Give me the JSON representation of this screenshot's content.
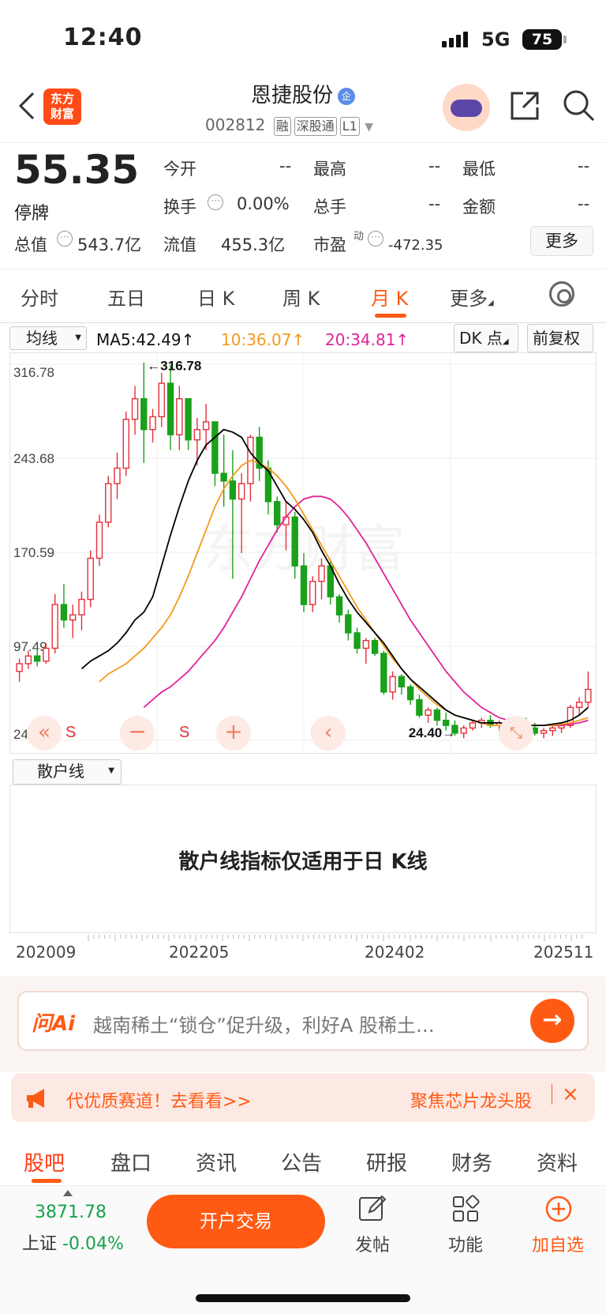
{
  "status": {
    "time": "12:40",
    "network": "5G",
    "battery": "75"
  },
  "header": {
    "logo": [
      "东方",
      "财富"
    ],
    "stock_name": "恩捷股份",
    "badge": "企",
    "code": "002812",
    "tags": [
      "融",
      "深股通",
      "L1"
    ]
  },
  "quote": {
    "price": "55.35",
    "status": "停牌",
    "rows": [
      [
        {
          "label": "今开",
          "value": "--"
        },
        {
          "label": "最高",
          "value": "--"
        },
        {
          "label": "最低",
          "value": "--"
        }
      ],
      [
        {
          "label": "换手",
          "value": "0.00%"
        },
        {
          "label": "总手",
          "value": "--"
        },
        {
          "label": "金额",
          "value": "--"
        }
      ]
    ],
    "total_value_label": "总值",
    "total_value": "543.7亿",
    "float_value_label": "流值",
    "float_value": "455.3亿",
    "pe_label": "市盈",
    "pe_sup": "动",
    "pe_value": "-472.35",
    "more": "更多"
  },
  "tabs": [
    "分时",
    "五日",
    "日 K",
    "周 K",
    "月 K",
    "更多"
  ],
  "active_tab": 4,
  "chart_controls": {
    "ma_select": "均线",
    "ma5": "MA5:42.49",
    "ma10": "10:36.07",
    "ma20": "20:34.81",
    "dk": "DK 点",
    "adjust": "前复权",
    "colors": {
      "ma5": "#000000",
      "ma10": "#f59a1b",
      "ma20": "#e0249a",
      "up": "#e5303a",
      "down": "#1aa01a"
    }
  },
  "chart_data": {
    "type": "candlestick",
    "y_ticks": [
      "316.78",
      "243.68",
      "170.59",
      "97.49",
      "24.40"
    ],
    "ylim": [
      24.4,
      316.78
    ],
    "x_ticks": [
      "202009",
      "202205",
      "202402",
      "202511"
    ],
    "annotations": {
      "max": "316.78",
      "min": "24.40"
    },
    "markers": [
      "S",
      "S",
      "SS"
    ],
    "ohlc": [
      [
        78,
        88,
        70,
        84
      ],
      [
        84,
        94,
        80,
        90
      ],
      [
        90,
        96,
        82,
        86
      ],
      [
        86,
        100,
        84,
        96
      ],
      [
        96,
        138,
        92,
        130
      ],
      [
        130,
        146,
        112,
        118
      ],
      [
        118,
        130,
        104,
        122
      ],
      [
        122,
        140,
        110,
        134
      ],
      [
        134,
        172,
        128,
        166
      ],
      [
        166,
        200,
        160,
        194
      ],
      [
        194,
        230,
        190,
        224
      ],
      [
        224,
        248,
        212,
        236
      ],
      [
        236,
        280,
        230,
        274
      ],
      [
        274,
        300,
        262,
        290
      ],
      [
        290,
        318,
        240,
        266
      ],
      [
        266,
        282,
        256,
        276
      ],
      [
        276,
        310,
        268,
        302
      ],
      [
        302,
        316,
        250,
        262
      ],
      [
        262,
        300,
        250,
        290
      ],
      [
        290,
        282,
        250,
        258
      ],
      [
        258,
        275,
        238,
        266
      ],
      [
        266,
        286,
        250,
        272
      ],
      [
        272,
        272,
        222,
        232
      ],
      [
        232,
        262,
        206,
        226
      ],
      [
        226,
        250,
        150,
        212
      ],
      [
        212,
        232,
        170,
        224
      ],
      [
        224,
        262,
        210,
        260
      ],
      [
        260,
        268,
        226,
        236
      ],
      [
        236,
        242,
        200,
        210
      ],
      [
        210,
        214,
        186,
        192
      ],
      [
        192,
        210,
        172,
        198
      ],
      [
        198,
        202,
        150,
        160
      ],
      [
        160,
        170,
        124,
        130
      ],
      [
        130,
        152,
        124,
        148
      ],
      [
        148,
        166,
        134,
        160
      ],
      [
        160,
        164,
        130,
        136
      ],
      [
        136,
        138,
        116,
        122
      ],
      [
        122,
        126,
        102,
        108
      ],
      [
        108,
        112,
        92,
        96
      ],
      [
        96,
        104,
        84,
        102
      ],
      [
        102,
        104,
        90,
        92
      ],
      [
        92,
        94,
        60,
        62
      ],
      [
        62,
        78,
        56,
        74
      ],
      [
        74,
        76,
        60,
        66
      ],
      [
        66,
        68,
        52,
        56
      ],
      [
        56,
        60,
        42,
        44
      ],
      [
        44,
        50,
        38,
        48
      ],
      [
        48,
        50,
        36,
        40
      ],
      [
        40,
        46,
        32,
        36
      ],
      [
        36,
        40,
        28,
        30
      ],
      [
        30,
        36,
        26,
        34
      ],
      [
        34,
        40,
        32,
        38
      ],
      [
        38,
        42,
        34,
        40
      ],
      [
        40,
        44,
        34,
        36
      ],
      [
        36,
        40,
        30,
        38
      ],
      [
        38,
        42,
        32,
        34
      ],
      [
        34,
        40,
        30,
        38
      ],
      [
        38,
        42,
        32,
        34
      ],
      [
        34,
        38,
        28,
        30
      ],
      [
        30,
        34,
        26,
        32
      ],
      [
        32,
        36,
        28,
        34
      ],
      [
        34,
        38,
        30,
        36
      ],
      [
        36,
        52,
        34,
        50
      ],
      [
        50,
        58,
        44,
        54
      ],
      [
        54,
        78,
        50,
        64
      ]
    ],
    "ma5": [
      80,
      86,
      90,
      94,
      100,
      108,
      118,
      124,
      136,
      160,
      184,
      206,
      226,
      242,
      254,
      260,
      266,
      264,
      260,
      248,
      240,
      234,
      222,
      210,
      204,
      196,
      186,
      172,
      160,
      146,
      134,
      124,
      116,
      108,
      100,
      90,
      80,
      72,
      66,
      60,
      54,
      48,
      44,
      42,
      40,
      38,
      38,
      38,
      37,
      36,
      36,
      36,
      36,
      37,
      38,
      40,
      44,
      50
    ],
    "ma10": [
      70,
      76,
      80,
      84,
      90,
      96,
      104,
      112,
      122,
      136,
      152,
      170,
      188,
      206,
      220,
      230,
      238,
      242,
      240,
      236,
      230,
      222,
      212,
      200,
      188,
      176,
      164,
      152,
      140,
      128,
      118,
      108,
      98,
      88,
      80,
      72,
      64,
      58,
      52,
      48,
      44,
      42,
      40,
      38,
      36,
      36,
      36,
      36,
      36,
      36,
      36,
      36,
      37,
      38,
      40,
      42
    ],
    "ma20": [
      50,
      56,
      62,
      66,
      72,
      78,
      86,
      94,
      102,
      112,
      124,
      136,
      150,
      164,
      176,
      188,
      198,
      206,
      212,
      214,
      214,
      212,
      206,
      198,
      188,
      178,
      166,
      154,
      142,
      130,
      118,
      108,
      98,
      88,
      78,
      70,
      62,
      56,
      50,
      46,
      42,
      40,
      38,
      36,
      36,
      36,
      36,
      36,
      37,
      38,
      40
    ]
  },
  "indicator": {
    "select": "散户线",
    "message": "散户线指标仅适用于日 K线"
  },
  "ai": {
    "logo": "问Ai",
    "text": "越南稀土“锁仓”促升级，利好A 股稀土…"
  },
  "promo": {
    "left": "代优质赛道！去看看>>",
    "right": "聚焦芯片龙头股"
  },
  "bottom_tabs": [
    "股吧",
    "盘口",
    "资讯",
    "公告",
    "研报",
    "财务",
    "资料"
  ],
  "footer": {
    "index_value": "3871.78",
    "index_name": "上证",
    "index_change": "-0.04%",
    "trade_button": "开户交易",
    "post": "发帖",
    "functions": "功能",
    "add_watch": "加自选"
  }
}
